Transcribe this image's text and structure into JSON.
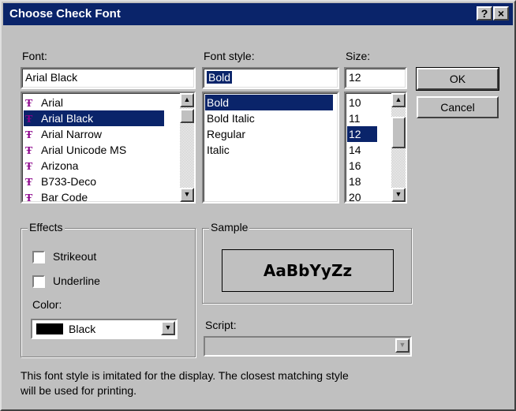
{
  "window": {
    "title": "Choose Check Font",
    "help_glyph": "?",
    "close_glyph": "×"
  },
  "font": {
    "label": "Font:",
    "value": "Arial Black",
    "items": [
      "Arial",
      "Arial Black",
      "Arial Narrow",
      "Arial Unicode MS",
      "Arizona",
      "B733-Deco",
      "Bar Code"
    ],
    "selected": "Arial Black",
    "item_icon": "truetype-icon"
  },
  "style": {
    "label": "Font style:",
    "value": "Bold",
    "items": [
      "Bold",
      "Bold Italic",
      "Regular",
      "Italic"
    ],
    "selected": "Bold"
  },
  "size": {
    "label": "Size:",
    "value": "12",
    "items": [
      "10",
      "11",
      "12",
      "14",
      "16",
      "18",
      "20"
    ],
    "selected": "12"
  },
  "buttons": {
    "ok": "OK",
    "cancel": "Cancel"
  },
  "effects": {
    "label": "Effects",
    "strikeout": "Strikeout",
    "underline": "Underline",
    "strikeout_checked": false,
    "underline_checked": false,
    "color_label": "Color:",
    "color_value": "Black",
    "color_swatch": "#000000"
  },
  "sample": {
    "label": "Sample",
    "text": "AaBbYyZz"
  },
  "script": {
    "label": "Script:",
    "value": ""
  },
  "note": {
    "line1": "This font style is imitated for the display. The closest matching style",
    "line2": "will be used for printing."
  },
  "colors": {
    "titlebar": "#0a246a",
    "selection": "#0a246a",
    "face": "#c0c0c0"
  }
}
